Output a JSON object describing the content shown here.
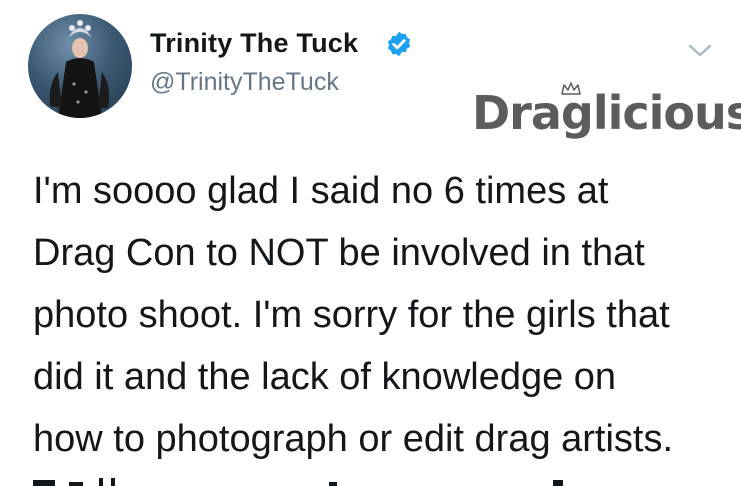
{
  "author": {
    "display_name": "Trinity The Tuck",
    "handle": "@TrinityTheTuck",
    "verified": true,
    "avatar_icon": "profile-photo"
  },
  "menu": {
    "icon": "chevron-down-icon"
  },
  "watermark": {
    "text": "Draglicious",
    "icon": "crown-icon",
    "color": "#5c5c5c"
  },
  "tweet": {
    "lines": [
      "I'm soooo glad I said no 6 times at",
      "Drag Con to NOT be involved in that",
      "photo shoot. I'm sorry for the girls that",
      "did it and the lack of knowledge on",
      "how to photograph or edit drag artists."
    ]
  },
  "colors": {
    "name": "#14171a",
    "handle": "#657786",
    "verified_badge": "#1da1f2",
    "chevron": "#aab8c2"
  }
}
